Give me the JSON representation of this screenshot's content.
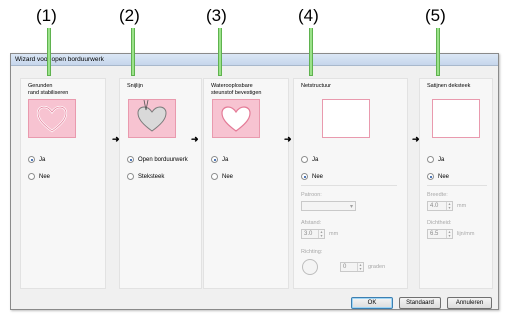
{
  "callouts": [
    "(1)",
    "(2)",
    "(3)",
    "(4)",
    "(5)"
  ],
  "window": {
    "title": "Wizard voor open borduurwerk"
  },
  "panels": [
    {
      "title": "Gerunde\nrand stabiliseren",
      "title_lines": [
        "Gerunden",
        "rand stabiliseren"
      ],
      "options": [
        "Ja",
        "Nee"
      ],
      "selected": "Ja"
    },
    {
      "title": "Snijlijn",
      "options": [
        "Open borduurwerk",
        "Steksteek"
      ],
      "selected": "Open borduurwerk"
    },
    {
      "title_lines": [
        "Waterooplosbare",
        "steunstof bevestigen"
      ],
      "options": [
        "Ja",
        "Nee"
      ],
      "selected": "Ja"
    },
    {
      "title": "Netstructuur",
      "options": [
        "Ja",
        "Nee"
      ],
      "selected": "Nee",
      "patroon_label": "Patroon:",
      "afstand_label": "Afstand:",
      "afstand_value": "3.0",
      "afstand_unit": "mm",
      "richting_label": "Richting:",
      "richting_value": "0",
      "richting_unit": "graden"
    },
    {
      "title": "Satijnen deksteek",
      "options": [
        "Ja",
        "Nee"
      ],
      "selected": "Nee",
      "breedte_label": "Breedte:",
      "breedte_value": "4.0",
      "breedte_unit": "mm",
      "dichtheid_label": "Dichtheid:",
      "dichtheid_value": "6.5",
      "dichtheid_unit": "lijn/mm"
    }
  ],
  "buttons": {
    "ok": "OK",
    "standaard": "Standaard",
    "annuleren": "Annuleren"
  },
  "colors": {
    "preview_pink": "#f7c3d1",
    "preview_border": "#e99aae",
    "callout_line": "#9be28a"
  }
}
